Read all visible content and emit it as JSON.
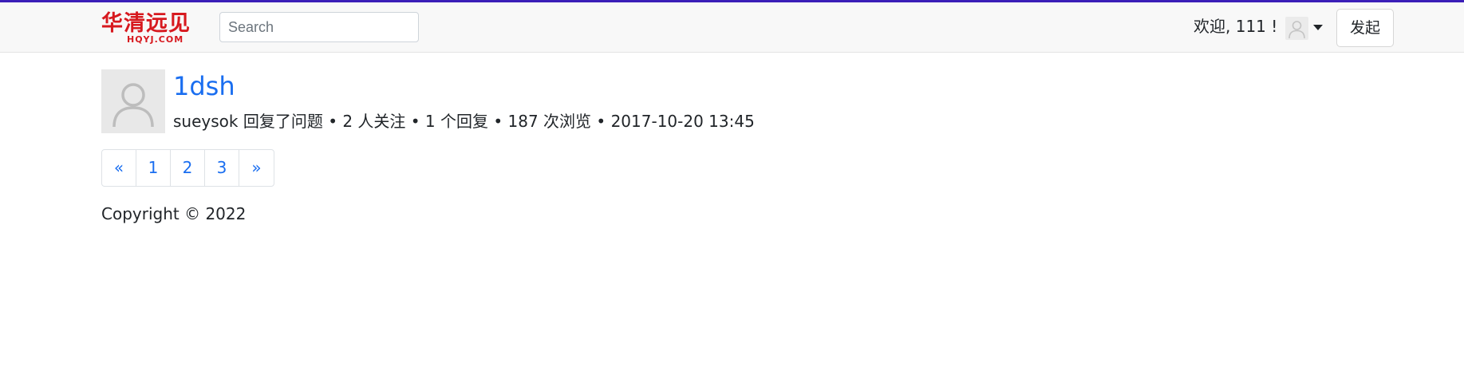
{
  "header": {
    "logo_text": "华清远见",
    "logo_subtext": "HQYJ.COM",
    "search_placeholder": "Search",
    "welcome_text": "欢迎, 111 !",
    "launch_label": "发起",
    "avatar_icon": "user-avatar-icon",
    "caret_icon": "caret-down-icon"
  },
  "question": {
    "title": "1dsh",
    "meta": "sueysok 回复了问题 • 2 人关注 • 1 个回复 • 187 次浏览 • 2017-10-20 13:45",
    "avatar_icon": "user-avatar-icon"
  },
  "pagination": {
    "prev": "«",
    "pages": [
      "1",
      "2",
      "3"
    ],
    "next": "»"
  },
  "footer": {
    "copyright": "Copyright © 2022"
  },
  "colors": {
    "accent_bar": "#3b1fb8",
    "link": "#1a6ef0",
    "logo": "#d7191f"
  }
}
